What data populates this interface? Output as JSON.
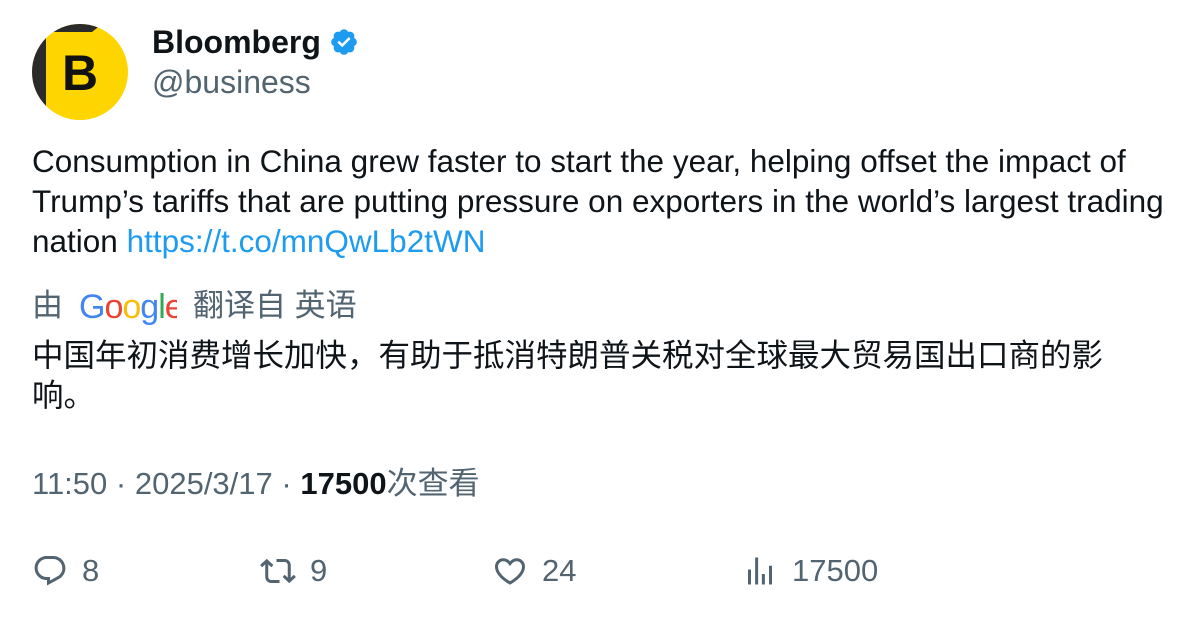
{
  "author": {
    "display_name": "Bloomberg",
    "handle": "@business",
    "avatar_letter": "B",
    "avatar_colors": {
      "background": "#ffd500",
      "dark": "#2b2b2b"
    },
    "verified_color": "#1d9bf0"
  },
  "tweet": {
    "text": "Consumption in China grew faster to start the year, helping offset the impact of Trump’s tariffs that are putting pressure on exporters in the world’s largest trading nation ",
    "link": "https://t.co/mnQwLb2tWN"
  },
  "translation": {
    "by_label": "由",
    "provider": "Google",
    "from_label": "翻译自 英语",
    "text": "中国年初消费增长加快，有助于抵消特朗普关税对全球最大贸易国出口商的影响。"
  },
  "meta": {
    "time": "11:50",
    "date": "2025/3/17",
    "separator": "·",
    "views_count": "17500",
    "views_label": "次查看"
  },
  "actions": {
    "replies": "8",
    "reposts": "9",
    "likes": "24",
    "views": "17500"
  },
  "colors": {
    "link": "#1d9bf0",
    "secondary_text": "#536471",
    "primary_text": "#0f1419"
  }
}
